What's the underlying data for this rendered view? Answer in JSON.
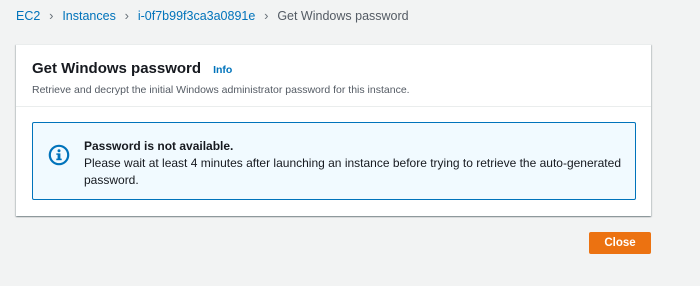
{
  "breadcrumb": {
    "items": [
      {
        "label": "EC2"
      },
      {
        "label": "Instances"
      },
      {
        "label": "i-0f7b99f3ca3a0891e"
      },
      {
        "label": "Get Windows password"
      }
    ],
    "separator": "›"
  },
  "panel": {
    "title": "Get Windows password",
    "info_label": "Info",
    "description": "Retrieve and decrypt the initial Windows administrator password for this instance."
  },
  "alert": {
    "icon": "info-icon",
    "title": "Password is not available.",
    "message": "Please wait at least 4 minutes after launching an instance before trying to retrieve the auto-generated password."
  },
  "footer": {
    "close_label": "Close"
  },
  "colors": {
    "link": "#0073bb",
    "primary_button": "#ec7211",
    "alert_background": "#f1faff",
    "alert_border": "#0073bb",
    "page_background": "#f2f3f3"
  }
}
